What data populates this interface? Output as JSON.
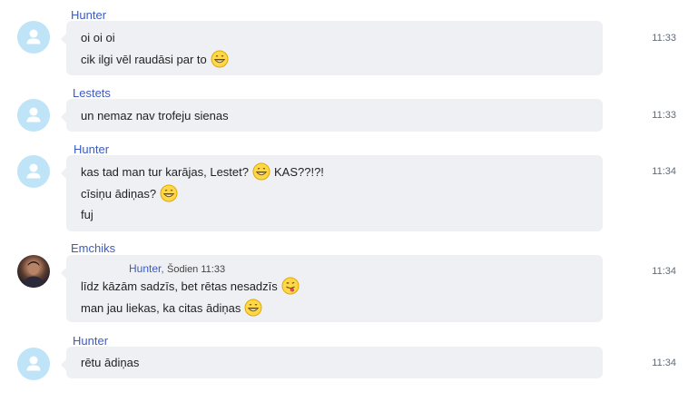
{
  "messages": [
    {
      "sender": "Hunter",
      "time": "11:33",
      "lines": [
        "oi oi oi",
        "cik ilgi vēl raudāsi par to"
      ]
    },
    {
      "sender": "Lestets",
      "time": "11:33",
      "lines": [
        "un nemaz nav trofeju sienas"
      ]
    },
    {
      "sender": "Hunter",
      "time": "11:34",
      "lines": [
        "kas tad man tur karājas, Lestet?",
        "KAS??!?!",
        "cīsiņu ādiņas?",
        "fuj"
      ]
    },
    {
      "sender": "Emchiks",
      "time": "11:34",
      "reply": {
        "author": "Hunter,",
        "when": "Šodien 11:33"
      },
      "lines": [
        "līdz kāzām sadzīs, bet rētas nesadzīs",
        "man jau liekas, ka citas ādiņas"
      ]
    },
    {
      "sender": "Hunter",
      "time": "11:34",
      "lines": [
        "rētu ādiņas"
      ]
    }
  ],
  "icons": {
    "default_avatar": "user-silhouette-icon",
    "grin_emoji": "grinning-emoji-icon",
    "tongue_emoji": "tongue-out-emoji-icon"
  },
  "colors": {
    "sender_name": "#3c5bc3",
    "bubble_bg": "#eef0f3",
    "avatar_bg": "#bfe3f7",
    "timestamp": "#5f6b7a"
  }
}
